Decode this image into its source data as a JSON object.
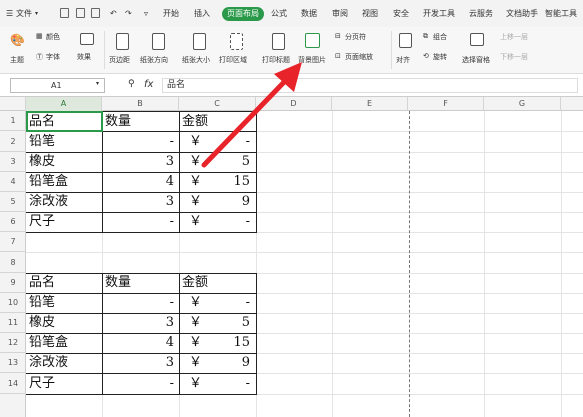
{
  "menubar": {
    "file_label": "文件",
    "tabs": [
      "开始",
      "插入",
      "页面布局",
      "公式",
      "数据",
      "审阅",
      "视图",
      "安全",
      "开发工具",
      "云服务",
      "文档助手",
      "智能工具"
    ],
    "active_tab": "页面布局"
  },
  "ribbon": {
    "theme_label": "主题",
    "colors_label": "颜色",
    "fonts_label": "字体",
    "effects_label": "效果",
    "margins_label": "页边距",
    "orientation_label": "纸张方向",
    "size_label": "纸张大小",
    "print_area_label": "打印区域",
    "print_titles_label": "打印标题",
    "background_label": "背景图片",
    "page_break_label": "分页符",
    "page_zoom_label": "页面缩放",
    "align_label": "对齐",
    "group_label": "组合",
    "rotate_label": "旋转",
    "selection_pane_label": "选择窗格",
    "bring_forward_label": "上移一层",
    "send_backward_label": "下移一层"
  },
  "formula_bar": {
    "cell_ref": "A1",
    "fx_label": "fx",
    "value": "品名"
  },
  "columns": [
    "A",
    "B",
    "C",
    "D",
    "E",
    "F",
    "G"
  ],
  "rows": [
    "1",
    "2",
    "3",
    "4",
    "5",
    "6",
    "7",
    "8",
    "9",
    "10",
    "11",
    "12",
    "13",
    "14"
  ],
  "table1": {
    "headers": [
      "品名",
      "数量",
      "金额"
    ],
    "rows": [
      {
        "name": "铅笔",
        "qty": "-",
        "cur": "￥",
        "amt": "-"
      },
      {
        "name": "橡皮",
        "qty": "3",
        "cur": "￥",
        "amt": "5"
      },
      {
        "name": "铅笔盒",
        "qty": "4",
        "cur": "￥",
        "amt": "15"
      },
      {
        "name": "涂改液",
        "qty": "3",
        "cur": "￥",
        "amt": "9"
      },
      {
        "name": "尺子",
        "qty": "-",
        "cur": "￥",
        "amt": "-"
      }
    ]
  },
  "table2": {
    "headers": [
      "品名",
      "数量",
      "金额"
    ],
    "rows": [
      {
        "name": "铅笔",
        "qty": "-",
        "cur": "￥",
        "amt": "-"
      },
      {
        "name": "橡皮",
        "qty": "3",
        "cur": "￥",
        "amt": "5"
      },
      {
        "name": "铅笔盒",
        "qty": "4",
        "cur": "￥",
        "amt": "15"
      },
      {
        "name": "涂改液",
        "qty": "3",
        "cur": "￥",
        "amt": "9"
      },
      {
        "name": "尺子",
        "qty": "-",
        "cur": "￥",
        "amt": "-"
      }
    ]
  },
  "colors": {
    "accent": "#2a9a4a",
    "arrow": "#e8232a"
  }
}
